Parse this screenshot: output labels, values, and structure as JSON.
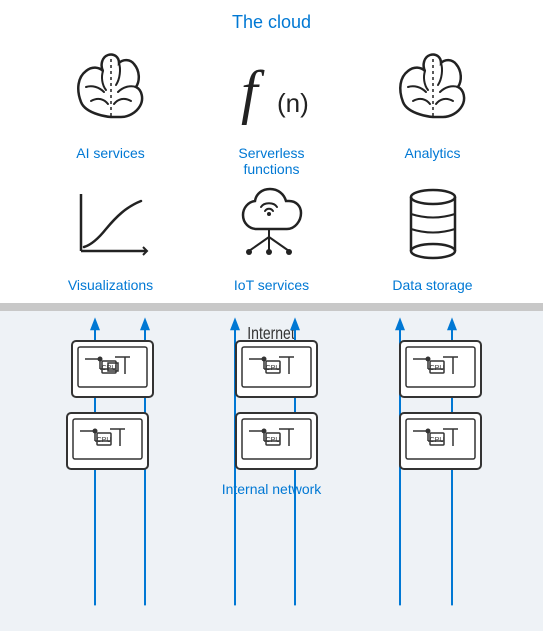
{
  "header": {
    "title": "The cloud"
  },
  "cloud_row1": [
    {
      "id": "ai-services",
      "label": "AI services"
    },
    {
      "id": "serverless",
      "label": "Serverless\nfunctions"
    },
    {
      "id": "analytics",
      "label": "Analytics"
    }
  ],
  "cloud_row2": [
    {
      "id": "visualizations",
      "label": "Visualizations"
    },
    {
      "id": "iot-services",
      "label": "IoT services"
    },
    {
      "id": "data-storage",
      "label": "Data storage"
    }
  ],
  "internet_label": "Internet",
  "internal_label": "Internal network",
  "colors": {
    "blue": "#0078d4",
    "divider": "#d0d0d0",
    "bg_bottom": "#f0f4f8"
  }
}
